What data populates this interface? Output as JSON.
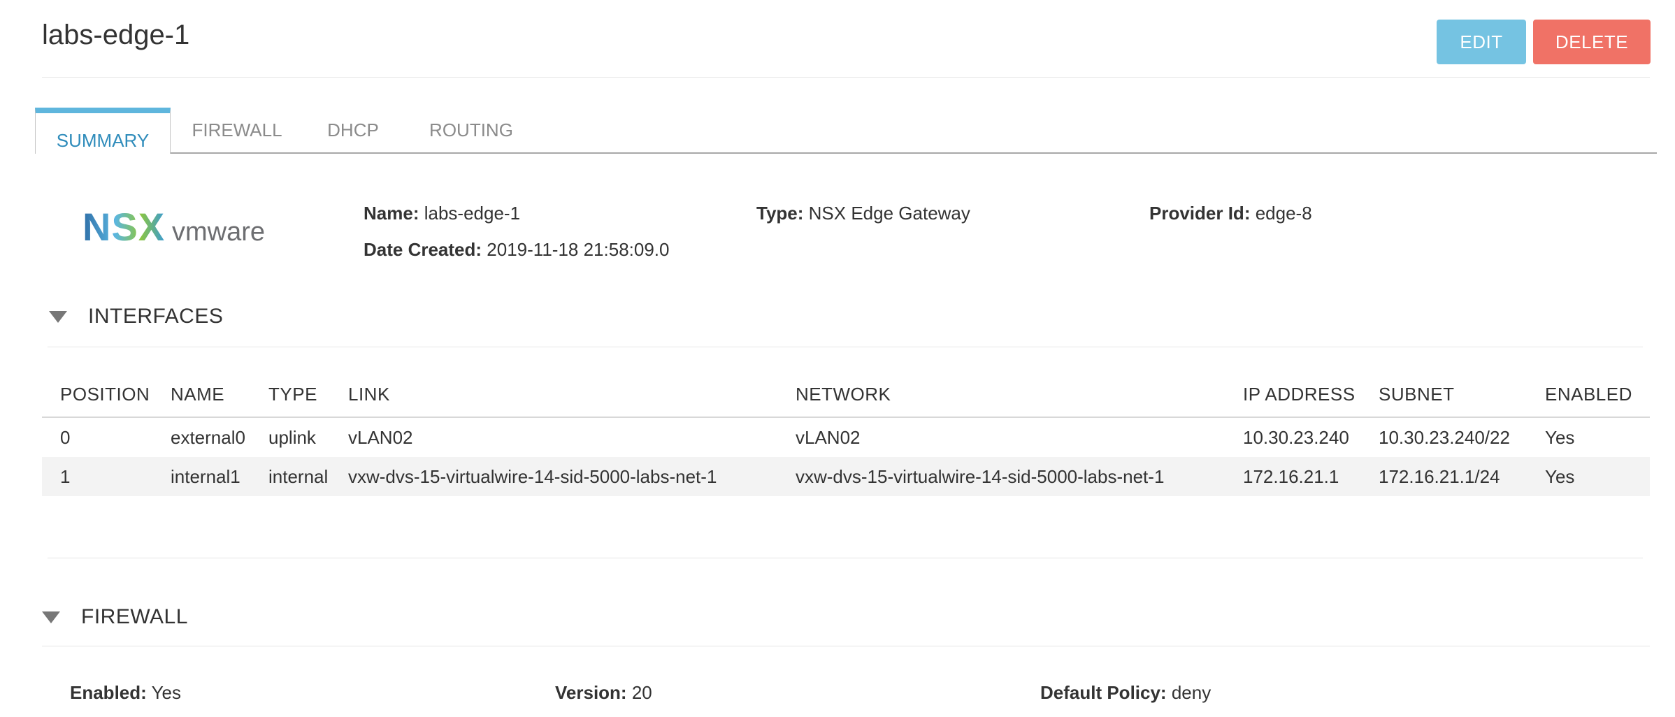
{
  "header": {
    "title": "labs-edge-1",
    "edit_label": "EDIT",
    "delete_label": "DELETE"
  },
  "tabs": [
    {
      "label": "SUMMARY",
      "active": true
    },
    {
      "label": "FIREWALL",
      "active": false
    },
    {
      "label": "DHCP",
      "active": false
    },
    {
      "label": "ROUTING",
      "active": false
    }
  ],
  "logo": {
    "nsx": "NSX",
    "vmware": "vmware",
    "icon": "nsx-vmware-logo"
  },
  "summary": {
    "name_label": "Name:",
    "name_value": "labs-edge-1",
    "type_label": "Type:",
    "type_value": "NSX Edge Gateway",
    "provider_label": "Provider Id:",
    "provider_value": "edge-8",
    "date_label": "Date Created:",
    "date_value": "2019-11-18 21:58:09.0"
  },
  "interfaces": {
    "title": "INTERFACES",
    "columns": [
      "POSITION",
      "NAME",
      "TYPE",
      "LINK",
      "NETWORK",
      "IP ADDRESS",
      "SUBNET",
      "ENABLED"
    ],
    "rows": [
      [
        "0",
        "external0",
        "uplink",
        "vLAN02",
        "vLAN02",
        "10.30.23.240",
        "10.30.23.240/22",
        "Yes"
      ],
      [
        "1",
        "internal1",
        "internal",
        "vxw-dvs-15-virtualwire-14-sid-5000-labs-net-1",
        "vxw-dvs-15-virtualwire-14-sid-5000-labs-net-1",
        "172.16.21.1",
        "172.16.21.1/24",
        "Yes"
      ]
    ]
  },
  "firewall": {
    "title": "FIREWALL",
    "enabled_label": "Enabled:",
    "enabled_value": "Yes",
    "version_label": "Version:",
    "version_value": "20",
    "policy_label": "Default Policy:",
    "policy_value": "deny"
  },
  "colors": {
    "edit": "#75c3e2",
    "delete": "#f07266",
    "active_tab": "#2f8cbb",
    "tab_indicator": "#5fb6dd"
  }
}
